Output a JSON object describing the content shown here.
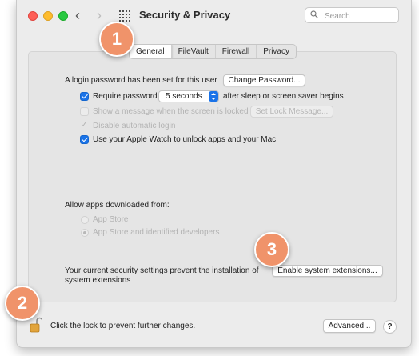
{
  "window": {
    "title": "Security & Privacy",
    "search_placeholder": "Search"
  },
  "tabs": [
    {
      "label": "General",
      "active": true
    },
    {
      "label": "FileVault",
      "active": false
    },
    {
      "label": "Firewall",
      "active": false
    },
    {
      "label": "Privacy",
      "active": false
    }
  ],
  "general": {
    "login_text": "A login password has been set for this user",
    "change_password_button": "Change Password...",
    "require_password_label": "Require password",
    "require_password_checked": true,
    "require_password_delay": "5 seconds",
    "after_sleep_text": "after sleep or screen saver begins",
    "show_message_label": "Show a message when the screen is locked",
    "set_lock_message_button": "Set Lock Message...",
    "disable_login_label": "Disable automatic login",
    "apple_watch_label": "Use your Apple Watch to unlock apps and your Mac",
    "apple_watch_checked": true,
    "allow_apps_heading": "Allow apps downloaded from:",
    "app_store_option": "App Store",
    "app_store_identified_option": "App Store and identified developers",
    "extensions_text_line1": "Your current security settings prevent the installation of",
    "extensions_text_line2": "system extensions",
    "enable_extensions_button": "Enable system extensions..."
  },
  "footer": {
    "lock_text": "Click the lock to prevent further changes.",
    "advanced_button": "Advanced...",
    "help_button": "?"
  },
  "callouts": [
    "1",
    "2",
    "3"
  ],
  "colors": {
    "accent": "#1a73e8",
    "callout": "#f0936a"
  }
}
